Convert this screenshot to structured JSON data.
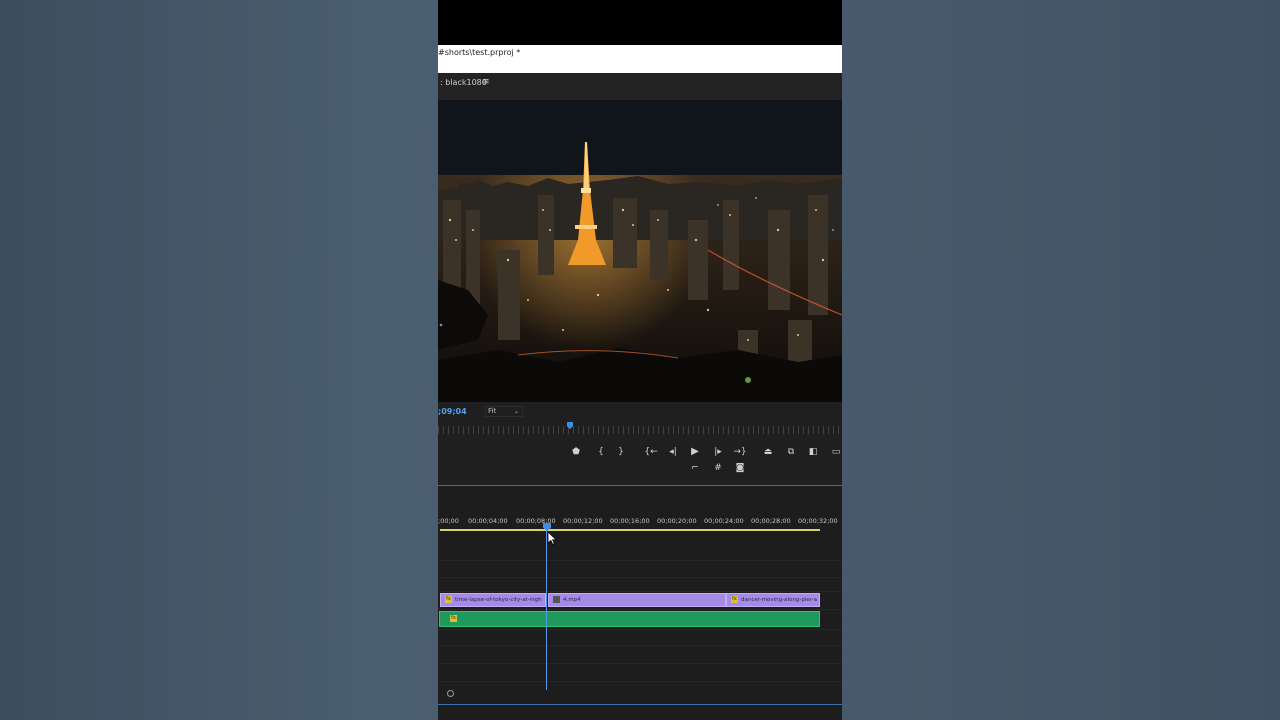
{
  "window": {
    "title": "#shorts\\test.prproj *"
  },
  "program_monitor": {
    "panel_label": ": black1080",
    "menu_icon": "hamburger-menu-icon",
    "timecode": ";09;04",
    "fit_value": "Fit"
  },
  "transport": {
    "row1": [
      "marker-icon",
      "mark-in-icon",
      "mark-out-icon",
      "go-to-in-icon",
      "step-back-icon",
      "play-icon",
      "step-forward-icon",
      "go-to-out-icon",
      "lift-icon",
      "extract-icon",
      "insert-icon",
      "overwrite-icon"
    ],
    "row2": [
      "trim-icon",
      "grid-icon",
      "camera-icon"
    ]
  },
  "timeline": {
    "ruler_labels": [
      ";00;00",
      "00;00;04;00",
      "00;00;08;00",
      "00;00;12;00",
      "00;00;16;00",
      "00;00;20;00",
      "00;00;24;00",
      "00;00;28;00",
      "00;00;32;00"
    ],
    "clips": [
      {
        "label": "time-lapse-of-tokyo-city-at-nigh",
        "fx": "fx"
      },
      {
        "label": "4.mp4",
        "fx": ""
      },
      {
        "label": "dancer-moving-along-pier-a",
        "fx": "fx"
      }
    ],
    "audio_fx": "fx"
  },
  "colors": {
    "accent": "#4ea1f3",
    "video_clip": "#a68be6",
    "audio_clip": "#1f9a5c",
    "work_area_bar": "#d6d36a"
  }
}
